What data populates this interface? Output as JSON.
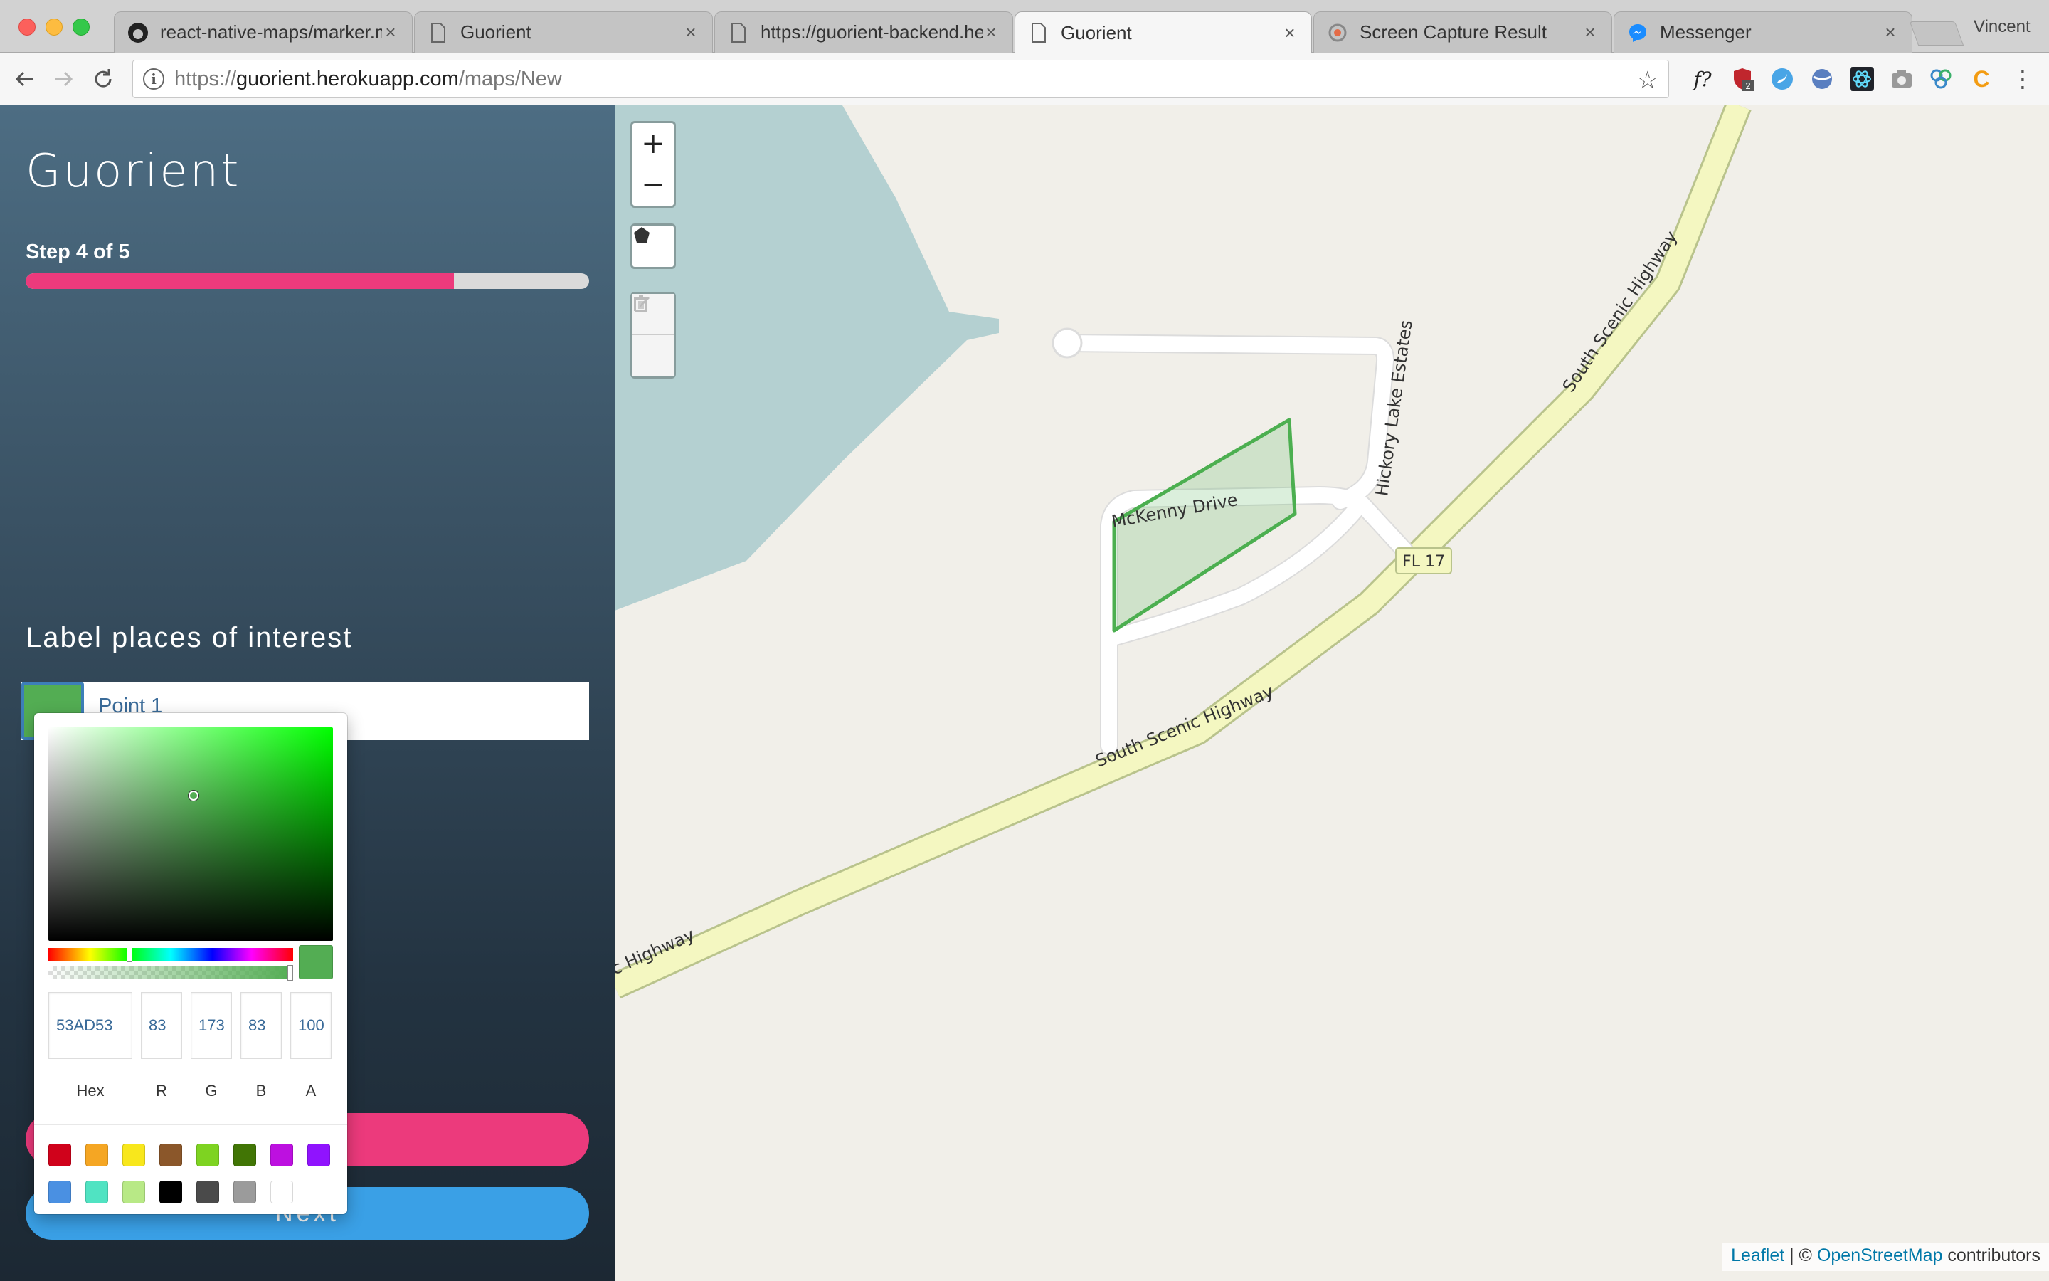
{
  "browser": {
    "tabs": [
      {
        "title": "react-native-maps/marker.m",
        "icon": "github-icon",
        "active": false
      },
      {
        "title": "Guorient",
        "icon": "page-icon",
        "active": false
      },
      {
        "title": "https://guorient-backend.he",
        "icon": "page-icon",
        "active": false
      },
      {
        "title": "Guorient",
        "icon": "page-icon",
        "active": true
      },
      {
        "title": "Screen Capture Result",
        "icon": "capture-icon",
        "active": false
      },
      {
        "title": "Messenger",
        "icon": "messenger-icon",
        "active": false
      }
    ],
    "profile": "Vincent",
    "url_prefix": "https://",
    "url_host": "guorient.herokuapp.com",
    "url_path": "/maps/New",
    "extension_badge": "2"
  },
  "sidebar": {
    "title": "Guorient",
    "step_label": "Step 4 of 5",
    "progress": 0.76,
    "section_heading": "Label places of interest",
    "point_value": "Point 1",
    "next_label": "Next"
  },
  "picker": {
    "hex": "53AD53",
    "r": "83",
    "g": "173",
    "b": "83",
    "a": "100",
    "labels": {
      "hex": "Hex",
      "r": "R",
      "g": "G",
      "b": "B",
      "a": "A"
    },
    "current_color": "#53AD53",
    "hue_fraction": 0.33,
    "alpha_fraction": 1.0,
    "presets": [
      "#D0021B",
      "#F5A623",
      "#F8E71C",
      "#8B572A",
      "#7ED321",
      "#417505",
      "#BD10E0",
      "#9013FE",
      "#4A90E2",
      "#50E3C2",
      "#B8E986",
      "#000000",
      "#4A4A4A",
      "#9B9B9B",
      "#FFFFFF"
    ]
  },
  "map": {
    "zoom_in": "+",
    "zoom_out": "−",
    "roads": {
      "south_scenic_1": "South Scenic Highway",
      "south_scenic_2": "South Scenic Highway",
      "south_scenic_3": "c Highway",
      "mckenny": "McKenny Drive",
      "hickory": "Hickory Lake Estates",
      "shield": "FL 17"
    },
    "polygon_color": "#4CAF50",
    "attribution": {
      "leaflet": "Leaflet",
      "sep": " | © ",
      "osm": "OpenStreetMap",
      "suffix": " contributors"
    }
  }
}
